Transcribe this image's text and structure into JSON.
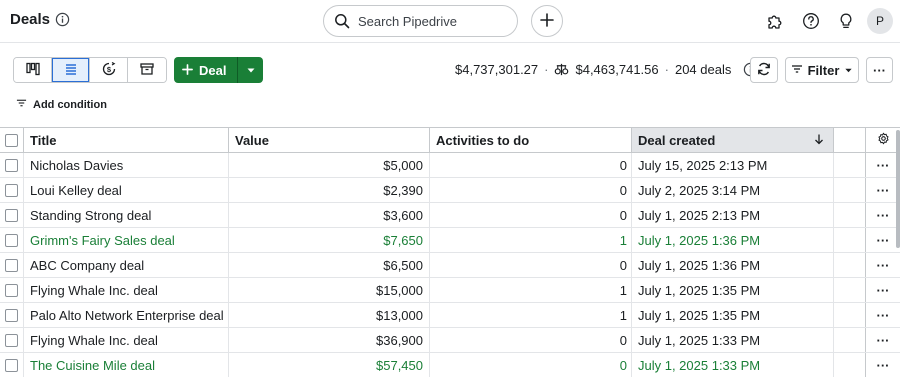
{
  "header": {
    "title": "Deals",
    "search_placeholder": "Search Pipedrive",
    "avatar_initial": "P"
  },
  "toolbar": {
    "views": [
      "pipeline-icon",
      "list-icon",
      "forecast-icon",
      "archive-icon"
    ],
    "active_view": "list",
    "deal_button_label": "Deal",
    "total_value": "$4,737,301.27",
    "weighted_value": "$4,463,741.56",
    "deal_count": "204 deals",
    "filter_label": "Filter",
    "add_condition_label": "Add condition"
  },
  "table": {
    "columns": [
      "Title",
      "Value",
      "Activities to do",
      "Deal created"
    ],
    "sorted_column": "Deal created",
    "sort_direction": "descending",
    "rows": [
      {
        "title": "Nicholas Davies",
        "value": "$5,000",
        "activities": "0",
        "created": "July 15, 2025 2:13 PM",
        "highlight": false
      },
      {
        "title": "Loui Kelley deal",
        "value": "$2,390",
        "activities": "0",
        "created": "July 2, 2025 3:14 PM",
        "highlight": false
      },
      {
        "title": "Standing Strong deal",
        "value": "$3,600",
        "activities": "0",
        "created": "July 1, 2025 2:13 PM",
        "highlight": false
      },
      {
        "title": "Grimm's Fairy Sales deal",
        "value": "$7,650",
        "activities": "1",
        "created": "July 1, 2025 1:36 PM",
        "highlight": true
      },
      {
        "title": "ABC Company deal",
        "value": "$6,500",
        "activities": "0",
        "created": "July 1, 2025 1:36 PM",
        "highlight": false
      },
      {
        "title": "Flying Whale Inc. deal",
        "value": "$15,000",
        "activities": "1",
        "created": "July 1, 2025 1:35 PM",
        "highlight": false
      },
      {
        "title": "Palo Alto Network Enterprise deal",
        "value": "$13,000",
        "activities": "1",
        "created": "July 1, 2025 1:35 PM",
        "highlight": false
      },
      {
        "title": "Flying Whale Inc. deal",
        "value": "$36,900",
        "activities": "0",
        "created": "July 1, 2025 1:33 PM",
        "highlight": false
      },
      {
        "title": "The Cuisine Mile deal",
        "value": "$57,450",
        "activities": "0",
        "created": "July 1, 2025 1:33 PM",
        "highlight": true
      }
    ]
  },
  "colors": {
    "primary_green": "#1a7f37",
    "accent_blue": "#2b6fd6",
    "text": "#1b1e21",
    "border": "#c6c9cc"
  }
}
